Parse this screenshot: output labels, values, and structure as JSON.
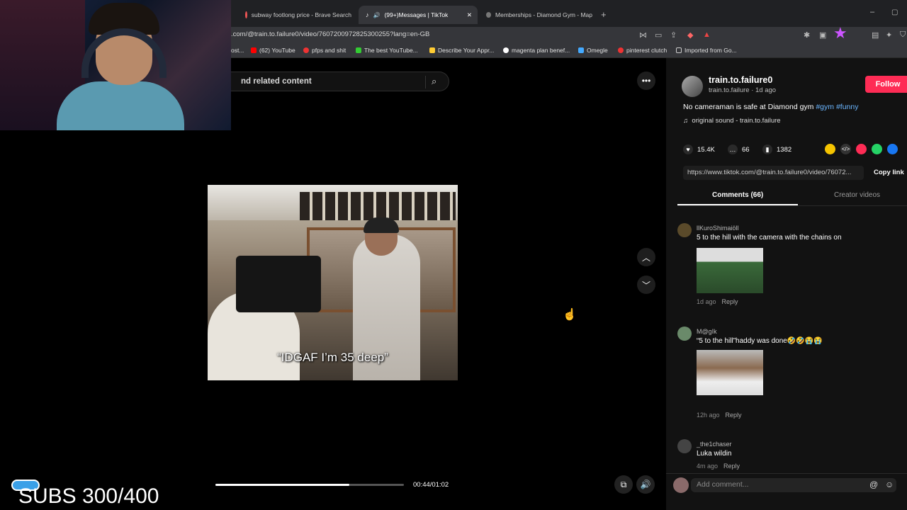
{
  "tabs": [
    {
      "title": "subway footlong price - Brave Search",
      "active": false
    },
    {
      "title": "(99+)Messages | TikTok",
      "active": true
    },
    {
      "title": "Memberships - Diamond Gym - Map",
      "active": false
    }
  ],
  "address_bar": {
    "url": ".com/@train.to.failure0/video/7607200972825300255?lang=en-GB"
  },
  "bookmarks": [
    "ost...",
    "(62) YouTube",
    "pfps and shit",
    "The best YouTube...",
    "Describe Your Appr...",
    "magenta plan benef...",
    "Omegle",
    "pinterest clutch",
    "Imported from Go..."
  ],
  "search": {
    "placeholder_text": "nd related content"
  },
  "video": {
    "subtitle": "“IDGAF I’m 35 deep”",
    "progress": 0.71,
    "time": "00:44/01:02"
  },
  "overlay": {
    "subs": "SUBS 300/400"
  },
  "author": {
    "username": "train.to.failure0",
    "subline": "train.to.failure · 1d ago",
    "follow_label": "Follow"
  },
  "description": {
    "text": "No cameraman is safe at Diamond gym ",
    "tags": [
      "#gym",
      "#funny"
    ],
    "sound": "original sound - train.to.failure"
  },
  "stats": {
    "likes": "15.4K",
    "comments": "66",
    "saves": "1382"
  },
  "link": {
    "url": "https://www.tiktok.com/@train.to.failure0/video/76072...",
    "copy_label": "Copy link"
  },
  "panel_tabs": {
    "comments": "Comments (66)",
    "creator": "Creator videos"
  },
  "comments": [
    {
      "user": "llKuroShimaiöll",
      "text": "5 to the hill with the camera with the chains on",
      "time": "1d ago",
      "reply": "Reply"
    },
    {
      "user": "M@gIk",
      "text": "“5 to the hill”haddy was done🤣🤣😭😭",
      "time": "12h ago",
      "reply": "Reply"
    },
    {
      "user": "_the1chaser",
      "text": "Luka wildin",
      "time": "4m ago",
      "reply": "Reply"
    }
  ],
  "add_comment": {
    "placeholder": "Add comment..."
  },
  "colors": {
    "follow": "#fe2c55",
    "tag": "#6bb6ff",
    "panel": "#121212"
  }
}
